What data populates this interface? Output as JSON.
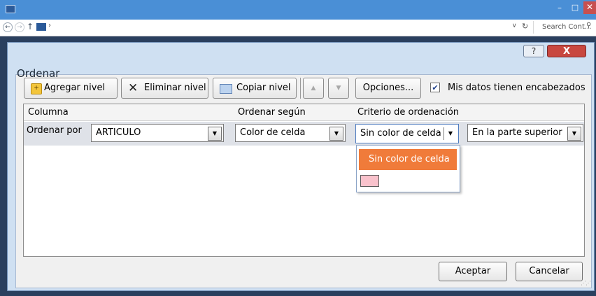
{
  "explorer": {
    "minimize": "–",
    "maximize": "□",
    "close": "✕",
    "search_placeholder": "Search Cont..."
  },
  "dialog": {
    "title": "Ordenar",
    "help": "?",
    "close": "X"
  },
  "toolbar": {
    "add_level": "Agregar nivel",
    "delete_level": "Eliminar nivel",
    "copy_level": "Copiar nivel",
    "options": "Opciones...",
    "headers_checked": true,
    "headers_label": "Mis datos tienen encabezados"
  },
  "grid": {
    "headers": {
      "column": "Columna",
      "sort_on": "Ordenar según",
      "order": "Criterio de ordenación"
    },
    "row": {
      "label": "Ordenar por",
      "column": "ARTICULO",
      "sort_on": "Color de celda",
      "order": "Sin color de celda",
      "position": "En la parte superior"
    }
  },
  "dropdown": {
    "options": [
      {
        "label": "Sin color de celda",
        "selected": true
      },
      {
        "label": "",
        "swatch": "#f9c2cc"
      }
    ]
  },
  "footer": {
    "ok": "Aceptar",
    "cancel": "Cancelar"
  },
  "colors": {
    "highlight": "#f07b3a",
    "swatch_pink": "#f9c2cc"
  }
}
